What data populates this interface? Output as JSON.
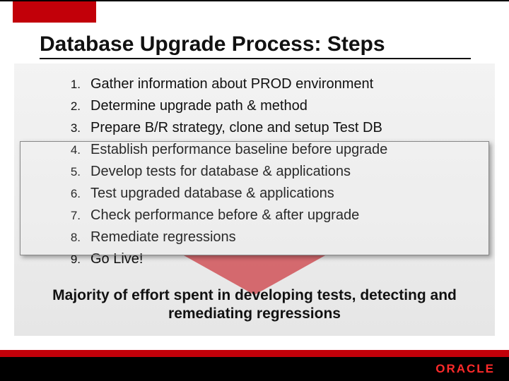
{
  "title": "Database Upgrade Process: Steps",
  "steps": [
    {
      "n": "1.",
      "text": "Gather information about PROD environment"
    },
    {
      "n": "2.",
      "text": "Determine upgrade path & method"
    },
    {
      "n": "3.",
      "text": "Prepare B/R strategy, clone and setup Test DB"
    },
    {
      "n": "4.",
      "text": "Establish performance baseline before upgrade"
    },
    {
      "n": "5.",
      "text": "Develop tests for database & applications"
    },
    {
      "n": "6.",
      "text": "Test upgraded database & applications"
    },
    {
      "n": "7.",
      "text": "Check performance before & after upgrade"
    },
    {
      "n": "8.",
      "text": "Remediate regressions"
    },
    {
      "n": "9.",
      "text": "Go Live!"
    }
  ],
  "highlight": {
    "from": 4,
    "to": 8
  },
  "caption": "Majority of effort spent in developing tests, detecting and remediating regressions",
  "footer": {
    "logo_text": "ORACLE"
  },
  "colors": {
    "brand_red": "#c20009",
    "black": "#000000"
  }
}
